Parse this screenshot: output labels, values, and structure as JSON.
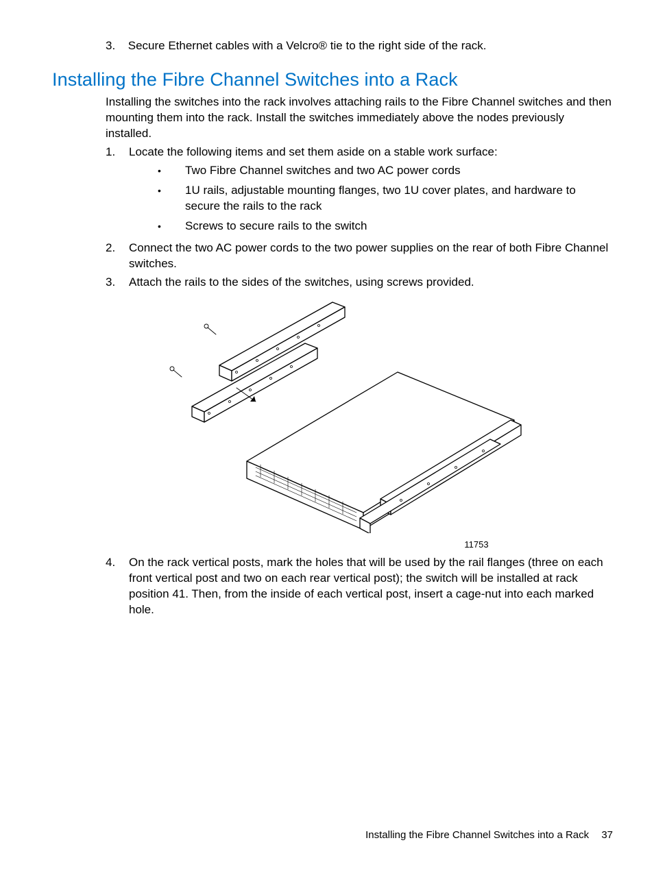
{
  "prev_step": {
    "num": "3.",
    "text": "Secure Ethernet cables with a Velcro® tie to the right side of the rack."
  },
  "heading": "Installing the Fibre Channel Switches into a Rack",
  "intro": "Installing the switches into the rack involves attaching rails to the Fibre Channel switches and then mounting them into the rack. Install the switches immediately above the nodes previously installed.",
  "steps": [
    {
      "num": "1.",
      "text": "Locate the following items and set them aside on a stable work surface:",
      "subs": [
        "Two Fibre Channel switches and two AC power cords",
        "1U rails, adjustable mounting flanges, two 1U cover plates, and hardware to secure the rails to the rack",
        "Screws to secure rails to the switch"
      ]
    },
    {
      "num": "2.",
      "text": "Connect the two AC power cords to the two power supplies on the rear of both Fibre Channel switches."
    },
    {
      "num": "3.",
      "text": "Attach the rails to the sides of the switches, using screws provided."
    },
    {
      "num": "4.",
      "text": "On the rack vertical posts, mark the holes that will be used by the rail flanges (three on each front vertical post and two on each rear vertical post); the switch will be installed at rack position 41. Then, from the inside of each vertical post, insert a cage-nut into each marked hole."
    }
  ],
  "figure_num": "11753",
  "footer_title": "Installing the Fibre Channel Switches into a Rack",
  "footer_page": "37"
}
